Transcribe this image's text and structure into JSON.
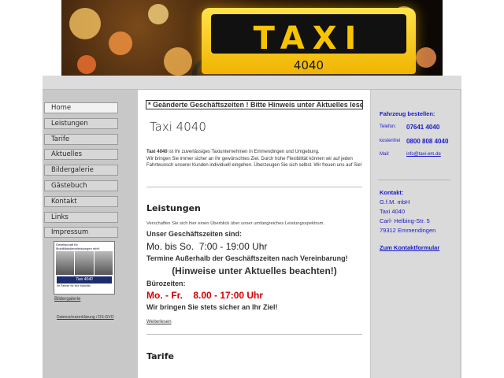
{
  "header": {
    "sign_text": "TAXI",
    "sign_number": "4040"
  },
  "nav": {
    "items": [
      {
        "label": "Home"
      },
      {
        "label": "Leistungen"
      },
      {
        "label": "Tarife"
      },
      {
        "label": "Aktuelles"
      },
      {
        "label": "Bildergalerie"
      },
      {
        "label": "Gästebuch"
      },
      {
        "label": "Kontakt"
      },
      {
        "label": "Links"
      },
      {
        "label": "Impressum"
      }
    ],
    "promo": {
      "heading": "Gesellschaft für Mobilitätsdienstleistungen mbH",
      "logo": "Taxi 4040",
      "footer": "Ihr Partner für Ihre Mobilität"
    },
    "gallery_link": "Bildergalerie",
    "privacy_link": "Datenschutzerklärung / DS-GVO"
  },
  "main": {
    "notice": "* Geänderte Geschäftszeiten ! Bitte Hinweis unter Aktuelles lesen",
    "title": "Taxi 4040",
    "intro_lead": "Taxi 4040",
    "intro_rest": " ist Ihr zuverlässiges Taxiunternehmen in Emmendingen und Umgebung.",
    "intro_2": "Wir bringen Sie immer sicher an Ihr gewünschtes Ziel. Durch hohe Flexibilität können wir auf jeden Fahrtwunsch unserer Kunden individuell eingehen. Überzeugen Sie sich selbst. Wir freuen uns auf Sie!",
    "services_title": "Leistungen",
    "services_intro": "Verschaffen Sie sich hier einen Überblick über unser umfangreiches Leistungsspektrum.",
    "hours_title": "Unser Geschäftszeiten sind:",
    "hours_days": "Mo. bis So.",
    "hours_time": "7:00 - 19:00 Uhr",
    "appointments": "Termine Außerhalb der Geschäftszeiten nach Vereinbarung!",
    "hint": "(Hinweise unter Aktuelles beachten!)",
    "office_title": "Bürozeiten:",
    "office_days": "Mo. - Fr.",
    "office_time": "8.00 - 17:00 Uhr",
    "safe": "Wir bringen Sie stets sicher an Ihr Ziel!",
    "more": "Weiterlesen",
    "tariffs_title": "Tarife"
  },
  "right": {
    "order_title": "Fahrzeug bestellen:",
    "phone_label": "Telefon:",
    "phone": "07641 4040",
    "free_label": "kostenfrei",
    "free": "0800 808 4040",
    "mail_label": "Mail:",
    "mail": "info@taxi-em.de",
    "contact_title": "Kontakt:",
    "contact_lines": [
      "G.f.M. mbH",
      "Taxi 4040",
      "Carl- Helbing-Str. 5",
      "79312 Emmendingen"
    ],
    "contact_form": "Zum Kontaktformular"
  },
  "colors": {
    "accent_blue": "#1a1ac8",
    "alert_red": "#d40000",
    "taxi_yellow": "#f8c400"
  }
}
